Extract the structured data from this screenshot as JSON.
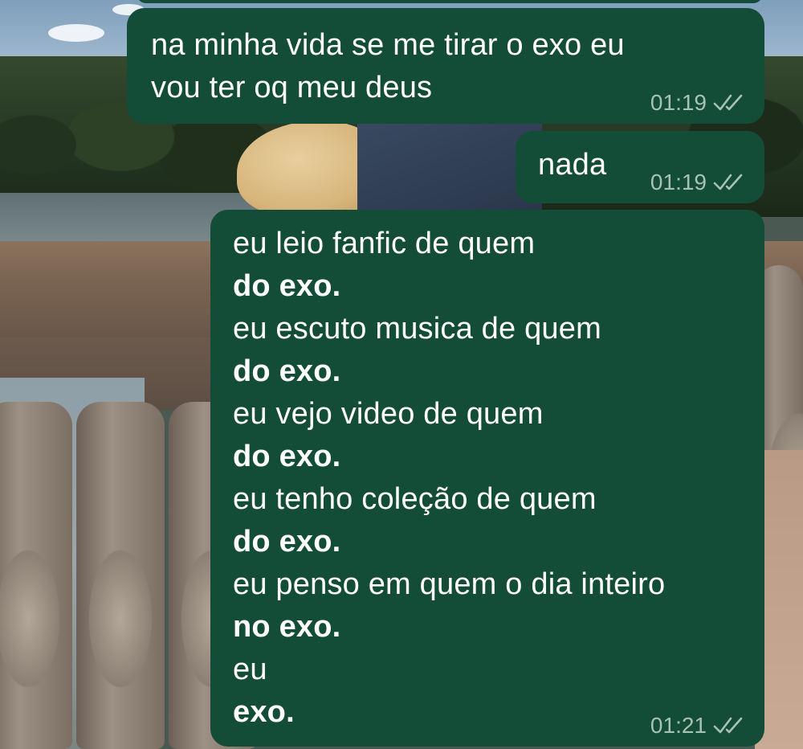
{
  "messages": [
    {
      "id": "msg1",
      "lines": [
        {
          "text": "na minha vida se me tirar o exo eu",
          "bold": false
        },
        {
          "text": "vou ter oq meu deus",
          "bold": false
        }
      ],
      "time": "01:19",
      "status_icon": "double-check-icon"
    },
    {
      "id": "msg2",
      "lines": [
        {
          "text": "nada",
          "bold": false
        }
      ],
      "time": "01:19",
      "status_icon": "double-check-icon"
    },
    {
      "id": "msg3",
      "lines": [
        {
          "text": "eu leio fanfic de quem",
          "bold": false
        },
        {
          "text": "do exo.",
          "bold": true
        },
        {
          "text": "eu escuto musica de quem",
          "bold": false
        },
        {
          "text": "do exo.",
          "bold": true
        },
        {
          "text": "eu vejo video de quem",
          "bold": false
        },
        {
          "text": "do exo.",
          "bold": true
        },
        {
          "text": "eu tenho coleção de quem",
          "bold": false
        },
        {
          "text": "do exo.",
          "bold": true
        },
        {
          "text": "eu penso em quem o dia inteiro",
          "bold": false
        },
        {
          "text": "no exo.",
          "bold": true
        },
        {
          "text": "eu",
          "bold": false
        },
        {
          "text": "exo.",
          "bold": true
        }
      ],
      "time": "01:21",
      "status_icon": "double-check-icon"
    }
  ],
  "colors": {
    "bubble_background": "#134d37",
    "message_text": "#ffffff",
    "meta_text": "#a8c1b5"
  }
}
